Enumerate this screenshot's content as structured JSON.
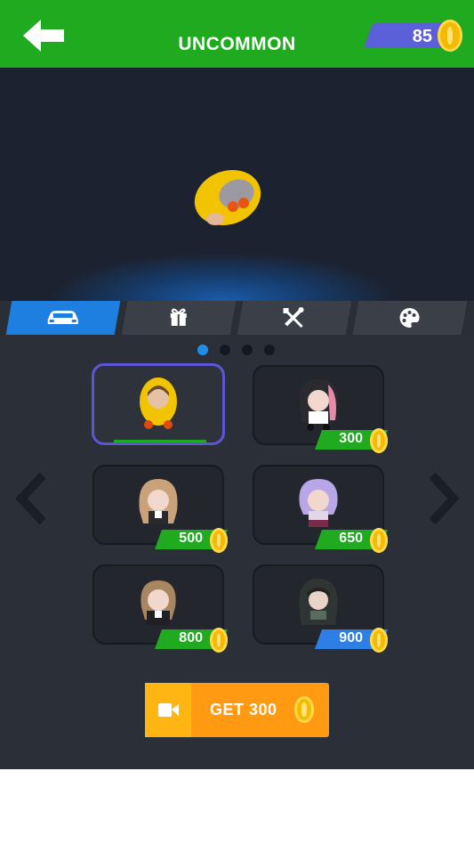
{
  "header": {
    "title": "UNCOMMON",
    "coins": "85"
  },
  "colors": {
    "header_green": "#1faa1f",
    "accent_blue": "#1e7fe0",
    "coin_gold": "#f5b900",
    "select_purple": "#5a56d6"
  },
  "tabs": [
    {
      "icon": "car-icon",
      "active": true
    },
    {
      "icon": "gift-icon",
      "active": false
    },
    {
      "icon": "tools-icon",
      "active": false
    },
    {
      "icon": "palette-icon",
      "active": false
    }
  ],
  "pagination": {
    "pages": 4,
    "current": 1
  },
  "items": [
    {
      "name": "yellow-hood-plush",
      "selected": true,
      "price": ""
    },
    {
      "name": "black-pink-hair-plush",
      "selected": false,
      "price": "300"
    },
    {
      "name": "blonde-hair-plush",
      "selected": false,
      "price": "500"
    },
    {
      "name": "purple-hair-plush",
      "selected": false,
      "price": "650"
    },
    {
      "name": "brown-hair-plush",
      "selected": false,
      "price": "800"
    },
    {
      "name": "dark-hood-plush",
      "selected": false,
      "price": "900"
    }
  ],
  "reward_button": {
    "label": "GET 300",
    "icon": "video-camera-icon"
  }
}
